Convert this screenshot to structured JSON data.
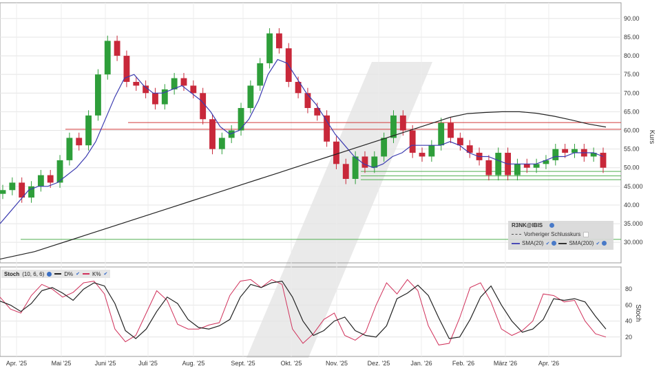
{
  "chart_data": [
    {
      "type": "candlestick",
      "symbol": "R3NK@IBIS",
      "ylabel": "Kurs",
      "ylim": [
        24.5,
        92
      ],
      "yticks": [
        "90.00",
        "85.00",
        "80.00",
        "75.00",
        "70.00",
        "65.00",
        "60.00",
        "55.00",
        "50.00",
        "45.000",
        "40.00",
        "35.000",
        "30.000"
      ],
      "ytick_values": [
        90,
        85,
        80,
        75,
        70,
        65,
        60,
        55,
        50,
        45,
        40,
        35,
        30
      ],
      "x_labels": [
        "Apr. '25",
        "Mai '25",
        "Juni '25",
        "Juli '25",
        "Aug. '25",
        "Sept. '25",
        "Okt. '25",
        "Nov. '25",
        "Dez. '25",
        "Jan. '26",
        "Feb. '26",
        "März '26",
        "Apr. '26"
      ],
      "close_series": [
        44,
        46,
        42,
        45,
        48,
        46,
        52,
        58,
        56,
        64,
        75,
        84,
        80,
        73,
        72,
        70,
        67,
        71,
        74,
        72,
        70,
        63,
        55,
        58,
        60,
        66,
        72,
        78,
        86,
        82,
        73,
        70,
        66,
        64,
        57,
        51,
        47,
        53,
        50,
        53,
        58,
        64,
        60,
        54,
        53,
        56,
        62,
        58,
        56,
        54,
        52,
        48,
        54,
        48,
        51,
        50,
        51,
        52,
        55,
        54,
        55,
        53,
        54,
        50
      ],
      "sma20": [
        35,
        38,
        41,
        44,
        45,
        45,
        46,
        48,
        50,
        53,
        57,
        63,
        69,
        74,
        75,
        72,
        70,
        70,
        71,
        72,
        70,
        68,
        65,
        61,
        59,
        60,
        63,
        68,
        75,
        79,
        78,
        74,
        70,
        67,
        63,
        59,
        56,
        53,
        51,
        50,
        51,
        53,
        54,
        56,
        56,
        56,
        56,
        57,
        56,
        54,
        53,
        53,
        52,
        51,
        51,
        51,
        51,
        52,
        53,
        53,
        54,
        54,
        54,
        53
      ],
      "sma200": [
        25.5,
        26.5,
        27.5,
        29,
        30.5,
        32,
        33.5,
        35,
        36.5,
        38,
        39.5,
        41,
        42.5,
        44,
        45.5,
        47,
        48.5,
        50,
        51.5,
        53,
        54.5,
        56,
        57.5,
        59,
        60.5,
        62,
        63.5,
        64.5,
        64.8,
        65,
        65,
        64.6,
        63.8,
        62.8,
        61.7,
        60.9
      ],
      "horizontal_lines": [
        {
          "value": 62.1,
          "color": "#d23a3a"
        },
        {
          "value": 60.3,
          "color": "#d23a3a"
        },
        {
          "value": 49.0,
          "color": "#4fae4f"
        },
        {
          "value": 47.8,
          "color": "#4fae4f"
        },
        {
          "value": 46.8,
          "color": "#4fae4f"
        },
        {
          "value": 30.8,
          "color": "#4fae4f"
        }
      ],
      "legend": {
        "symbol": "R3NK@IBIS",
        "prev_close": "Vorheriger Schlusskurs",
        "sma20": "SMA(20)",
        "sma200": "SMA(200)"
      },
      "colors": {
        "up": "#2e9e3a",
        "down": "#c8283a",
        "sma20": "#3b3bb0",
        "sma200": "#222222"
      }
    },
    {
      "type": "line",
      "title": "Stoch",
      "params": "(10, 6, 6)",
      "ylabel": "Stoch",
      "ylim": [
        6,
        94
      ],
      "yticks": [
        "80",
        "60",
        "40",
        "20"
      ],
      "ytick_values": [
        80,
        60,
        40,
        20
      ],
      "series": [
        {
          "name": "D%",
          "color": "#222222",
          "values": [
            65,
            60,
            52,
            62,
            78,
            82,
            75,
            66,
            80,
            88,
            84,
            62,
            28,
            18,
            30,
            52,
            70,
            62,
            42,
            32,
            30,
            34,
            42,
            70,
            86,
            82,
            88,
            90,
            70,
            40,
            22,
            28,
            40,
            45,
            28,
            22,
            20,
            34,
            68,
            75,
            85,
            72,
            44,
            18,
            20,
            42,
            70,
            84,
            60,
            40,
            26,
            30,
            42,
            68,
            66,
            68,
            64,
            46,
            30
          ]
        },
        {
          "name": "K%",
          "color": "#d0305a",
          "values": [
            70,
            55,
            50,
            72,
            86,
            80,
            70,
            76,
            88,
            90,
            74,
            30,
            14,
            22,
            50,
            78,
            66,
            36,
            30,
            30,
            35,
            38,
            72,
            90,
            92,
            82,
            92,
            86,
            30,
            12,
            24,
            42,
            50,
            22,
            16,
            26,
            60,
            88,
            74,
            92,
            78,
            34,
            10,
            12,
            44,
            82,
            88,
            64,
            30,
            22,
            28,
            40,
            74,
            72,
            64,
            66,
            40,
            24,
            20
          ]
        }
      ],
      "legend": {
        "title": "Stoch",
        "params": "(10, 6, 6)",
        "d_label": "D%",
        "k_label": "K%"
      }
    }
  ]
}
